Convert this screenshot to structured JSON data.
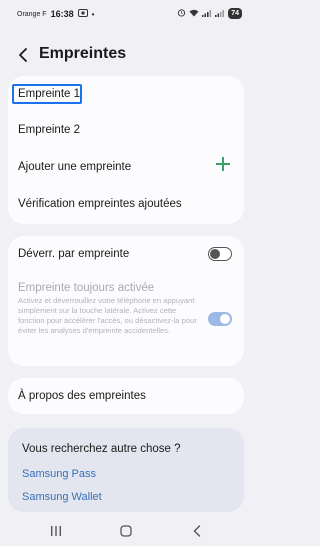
{
  "status_bar": {
    "carrier": "Orange F",
    "time": "16:38",
    "battery": "74"
  },
  "header": {
    "title": "Empreintes"
  },
  "fingerprints": {
    "items": [
      "Empreinte 1",
      "Empreinte 2"
    ],
    "add_label": "Ajouter une empreinte",
    "check_label": "Vérification empreintes ajoutées"
  },
  "unlock": {
    "label": "Déverr. par empreinte",
    "toggle_on": false,
    "always_on_title": "Empreinte toujours activée",
    "always_on_description": "Activez et déverrouillez votre téléphone en appuyant simplement sur la touche latérale. Activez cette fonction pour accélérer l'accès, ou désactivez-la pour éviter les analyses d'empreinte accidentelles.",
    "always_on_toggle_on": true
  },
  "about": {
    "label": "À propos des empreintes"
  },
  "suggestions": {
    "title": "Vous recherchez autre chose ?",
    "links": [
      "Samsung Pass",
      "Samsung Wallet"
    ]
  },
  "colors": {
    "accent_blue": "#1a73e8",
    "link_blue": "#3a6fb7",
    "plus_green": "#3aa36b",
    "background": "#f1f1f5"
  }
}
